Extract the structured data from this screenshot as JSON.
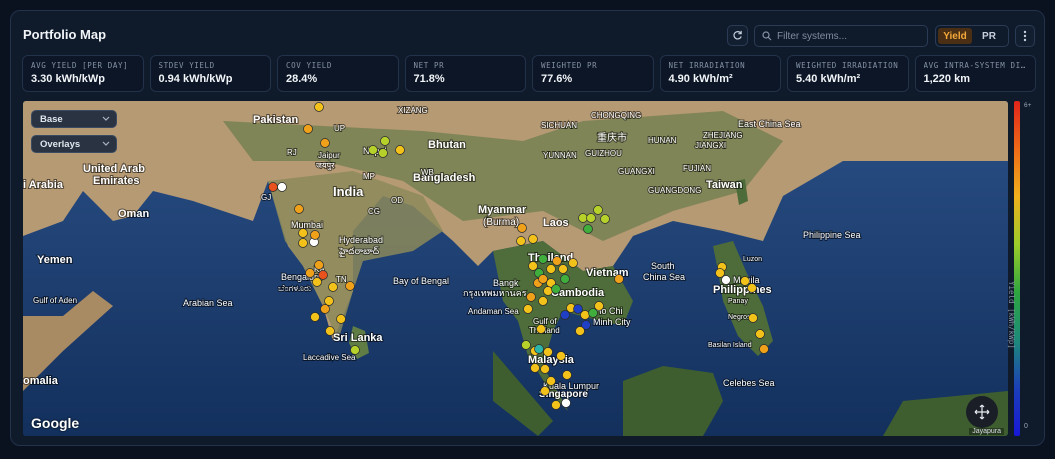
{
  "header": {
    "title": "Portfolio Map",
    "search_placeholder": "Filter systems...",
    "toggle": [
      {
        "label": "Yield",
        "active": true
      },
      {
        "label": "PR",
        "active": false
      }
    ]
  },
  "stats": [
    {
      "label": "AVG YIELD [PER DAY]",
      "value": "3.30 kWh/kWp"
    },
    {
      "label": "STDEV YIELD",
      "value": "0.94 kWh/kWp"
    },
    {
      "label": "COV YIELD",
      "value": "28.4%"
    },
    {
      "label": "NET PR",
      "value": "71.8%"
    },
    {
      "label": "WEIGHTED PR",
      "value": "77.6%"
    },
    {
      "label": "NET IRRADIATION",
      "value": "4.90 kWh/m²"
    },
    {
      "label": "WEIGHTED IRRADIATION",
      "value": "5.40 kWh/m²"
    },
    {
      "label": "AVG INTRA-SYSTEM DISTANCE",
      "value": "1,220 km"
    }
  ],
  "map": {
    "dropdowns": {
      "base": "Base",
      "overlays": "Overlays"
    },
    "provider": "Google",
    "attribution": "Jayapura",
    "labels": {
      "pakistan": "Pakistan",
      "india": "India",
      "nepal": "Nepal",
      "bhutan": "Bhutan",
      "bangladesh": "Bangladesh",
      "myanmar": "Myanmar",
      "myanmar2": "(Burma)",
      "laos": "Laos",
      "thailand": "Thailand",
      "cambodia": "Cambodia",
      "vietnam": "Vietnam",
      "malaysia": "Malaysia",
      "singapore": "Singapore",
      "philippines": "Philippines",
      "taiwan": "Taiwan",
      "srilanka": "Sri Lanka",
      "oman": "Oman",
      "yemen": "Yemen",
      "uae1": "United Arab",
      "uae2": "Emirates",
      "saudi": "i Arabia",
      "somalia": "omalia",
      "mumbai": "Mumbai",
      "hyderabad": "Hyderabad",
      "hyderabad_local": "హైదరాబాద్",
      "bengaluru": "Bengaluru",
      "bengaluru_local": "ಬೆಂಗಳೂರು",
      "jaipur": "Jaipur",
      "jaipur_local": "जयपुर",
      "bangkok": "Bangk",
      "bangkok_local": "กรุงเทพมหานคร",
      "hcmc1": "Ho Chi",
      "hcmc2": "Minh City",
      "kl": "Kuala Lumpur",
      "manila": "Manila",
      "arabian_sea": "Arabian Sea",
      "bay_bengal": "Bay of Bengal",
      "andaman": "Andaman Sea",
      "gulf_thailand1": "Gulf of",
      "gulf_thailand2": "Thailand",
      "south_china_sea1": "South",
      "south_china_sea2": "China Sea",
      "philippine_sea": "Philippine Sea",
      "east_china_sea": "East China Sea",
      "celebes": "Celebes Sea",
      "laccadive": "Laccadive Sea",
      "gulf_aden": "Gulf of Aden",
      "chongqing": "CHONGQING",
      "chongqing_local": "重庆市",
      "sichuan": "SICHUAN",
      "hunan": "HUNAN",
      "jiangxi": "JIANGXI",
      "zhejiang": "ZHEJIANG",
      "fujian": "FUJIAN",
      "guizhou": "GUIZHOU",
      "guangxi": "GUANGXI",
      "guangdong": "GUANGDONG",
      "yunnan": "YUNNAN",
      "xizang": "XIZANG",
      "up": "UP",
      "rj": "RJ",
      "mp": "MP",
      "gj": "GJ",
      "od": "OD",
      "cg": "CG",
      "ka": "KA",
      "wb": "WB",
      "tn": "TN",
      "luzon": "Luzon",
      "panay": "Panay",
      "negros": "Negros",
      "basilan": "Basilan Island"
    }
  },
  "legend": {
    "title": "Yield [kWh/kWp]",
    "max": "6+",
    "min": "0"
  },
  "colors": {
    "accent": "#f5a93b",
    "high": "#e0241b",
    "mid": "#f0b01c",
    "low": "#1818d8"
  }
}
